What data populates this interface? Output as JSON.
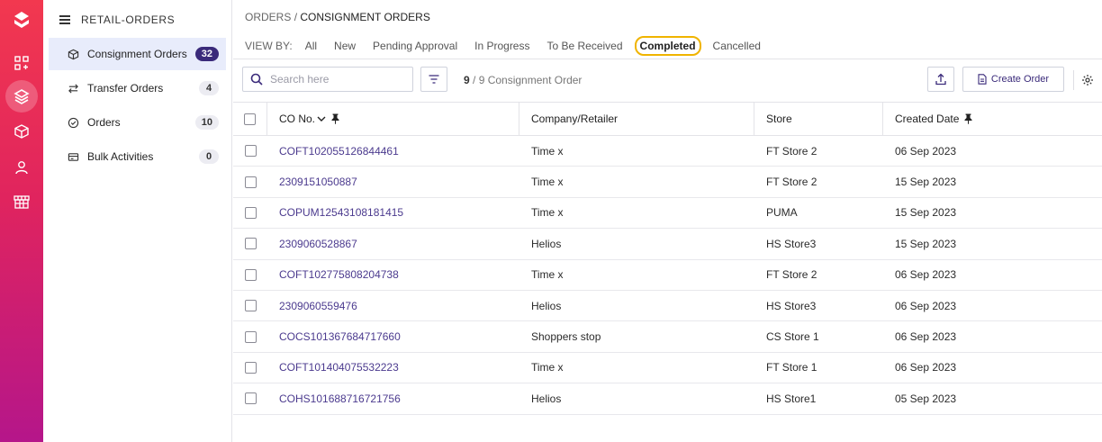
{
  "sidebar": {
    "title": "RETAIL-ORDERS",
    "items": [
      {
        "label": "Consignment Orders",
        "count": "32"
      },
      {
        "label": "Transfer Orders",
        "count": "4"
      },
      {
        "label": "Orders",
        "count": "10"
      },
      {
        "label": "Bulk Activities",
        "count": "0"
      }
    ]
  },
  "breadcrumb": {
    "root": "ORDERS",
    "separator": "/",
    "current": "CONSIGNMENT ORDERS"
  },
  "view_by": {
    "label": "VIEW BY:",
    "tabs": [
      "All",
      "New",
      "Pending Approval",
      "In Progress",
      "To Be Received",
      "Completed",
      "Cancelled"
    ],
    "selected": "Completed"
  },
  "toolbar": {
    "search_placeholder": "Search here",
    "count_shown": "9",
    "count_text": "/ 9 Consignment Order",
    "create_label": "Create Order"
  },
  "table": {
    "columns": [
      "CO No.",
      "Company/Retailer",
      "Store",
      "Created Date"
    ],
    "rows": [
      {
        "co": "COFT102055126844461",
        "company": "Time x",
        "store": "FT Store 2",
        "date": "06 Sep 2023"
      },
      {
        "co": "2309151050887",
        "company": "Time x",
        "store": "FT Store 2",
        "date": "15 Sep 2023"
      },
      {
        "co": "COPUM12543108181415",
        "company": "Time x",
        "store": "PUMA",
        "date": "15 Sep 2023"
      },
      {
        "co": "2309060528867",
        "company": "Helios",
        "store": "HS Store3",
        "date": "15 Sep 2023"
      },
      {
        "co": "COFT102775808204738",
        "company": "Time x",
        "store": "FT Store 2",
        "date": "06 Sep 2023"
      },
      {
        "co": "2309060559476",
        "company": "Helios",
        "store": "HS Store3",
        "date": "06 Sep 2023"
      },
      {
        "co": "COCS101367684717660",
        "company": "Shoppers stop",
        "store": "CS Store 1",
        "date": "06 Sep 2023"
      },
      {
        "co": "COFT101404075532223",
        "company": "Time x",
        "store": "FT Store 1",
        "date": "06 Sep 2023"
      },
      {
        "co": "COHS101688716721756",
        "company": "Helios",
        "store": "HS Store1",
        "date": "05 Sep 2023"
      }
    ]
  },
  "icons": {
    "rail": [
      "app-logo-icon",
      "dashboard-icon",
      "layers-icon",
      "box-icon",
      "user-icon",
      "store-icon"
    ],
    "sidebar": [
      "box-icon",
      "transfer-icon",
      "check-circle-icon",
      "card-icon"
    ]
  },
  "colors": {
    "accent": "#3a2a7a",
    "link": "#4b3a8e",
    "rail_top": "#f2384f",
    "rail_bottom": "#b5168a",
    "highlight": "#f0b400"
  }
}
